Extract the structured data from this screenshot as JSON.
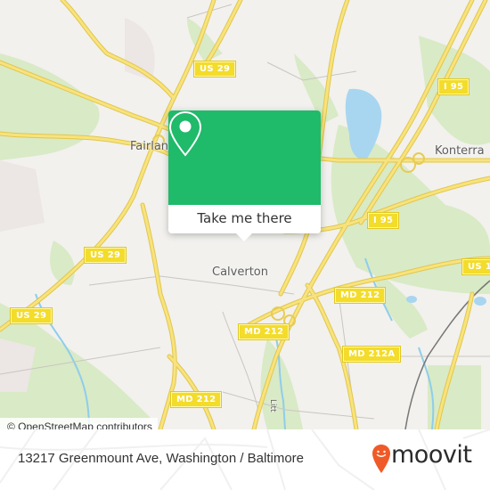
{
  "map": {
    "place_labels": [
      {
        "id": "fairland",
        "text": "Fairland"
      },
      {
        "id": "konterra",
        "text": "Konterra"
      },
      {
        "id": "calverton",
        "text": "Calverton"
      }
    ],
    "road_shields": [
      {
        "id": "us29-top",
        "text": "US 29"
      },
      {
        "id": "i95-top",
        "text": "I 95"
      },
      {
        "id": "i95-mid",
        "text": "I 95"
      },
      {
        "id": "us29-left-mid",
        "text": "US 29"
      },
      {
        "id": "us29-left-low",
        "text": "US 29"
      },
      {
        "id": "md212-center",
        "text": "MD 212"
      },
      {
        "id": "md212-right",
        "text": "MD 212"
      },
      {
        "id": "us1",
        "text": "US 1"
      },
      {
        "id": "md212a",
        "text": "MD 212A"
      },
      {
        "id": "md212-bottom",
        "text": "MD 212"
      }
    ],
    "minor_label": "Litt",
    "attribution": "© OpenStreetMap contributors",
    "colors": {
      "land": "#f2f1ee",
      "park": "#d5e8c0",
      "water": "#9fd3ef",
      "road": "#f5e07a",
      "road_casing": "#e6c84a"
    }
  },
  "popup": {
    "action_label": "Take me there",
    "icon": "location-pin-icon",
    "accent_color": "#1fba6a"
  },
  "footer": {
    "address": "13217 Greenmount Ave, Washington / Baltimore",
    "brand": "moovit",
    "brand_color": "#f05a28"
  }
}
